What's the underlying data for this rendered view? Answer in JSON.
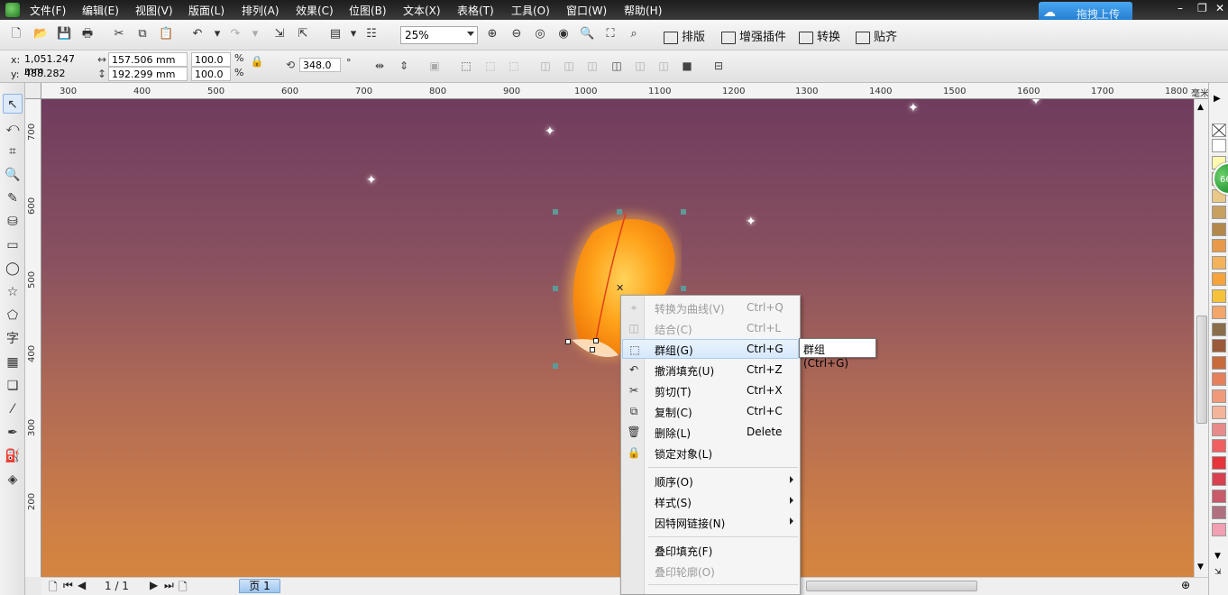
{
  "menubar": {
    "items": [
      "文件(F)",
      "编辑(E)",
      "视图(V)",
      "版面(L)",
      "排列(A)",
      "效果(C)",
      "位图(B)",
      "文本(X)",
      "表格(T)",
      "工具(O)",
      "窗口(W)",
      "帮助(H)"
    ],
    "upload_label": "拖拽上传"
  },
  "toolbar": {
    "zoom_value": "25%",
    "btn_layout": "排版",
    "btn_plugins": "增强插件",
    "btn_convert": "转换",
    "btn_snap": "贴齐"
  },
  "propbar": {
    "x_label": "x:",
    "x_value": "1,051.247 mm",
    "y_label": "y:",
    "y_value": "488.282 mm",
    "width_value": "157.506 mm",
    "height_value": "192.299 mm",
    "scale_x": "100.0",
    "scale_y": "100.0",
    "percent": "%",
    "rotation": "348.0",
    "degree": "°"
  },
  "ruler": {
    "unit": "毫米",
    "h_ticks": [
      "300",
      "400",
      "500",
      "600",
      "700",
      "800",
      "900",
      "1000",
      "1100",
      "1200",
      "1300",
      "1400",
      "1500",
      "1600",
      "1700",
      "1800"
    ],
    "v_ticks": [
      "700",
      "600",
      "500",
      "400",
      "300",
      "200"
    ]
  },
  "context_menu": {
    "items": [
      {
        "label": "转换为曲线(V)",
        "shortcut": "Ctrl+Q",
        "icon": "convert-curve-icon"
      },
      {
        "label": "结合(C)",
        "shortcut": "Ctrl+L",
        "icon": "combine-icon"
      },
      {
        "label": "群组(G)",
        "shortcut": "Ctrl+G",
        "icon": "group-icon"
      },
      {
        "label": "撤消填充(U)",
        "shortcut": "Ctrl+Z",
        "icon": "undo-icon"
      },
      {
        "label": "剪切(T)",
        "shortcut": "Ctrl+X",
        "icon": "scissors-icon"
      },
      {
        "label": "复制(C)",
        "shortcut": "Ctrl+C",
        "icon": "copy-icon"
      },
      {
        "label": "删除(L)",
        "shortcut": "Delete",
        "icon": "trash-icon"
      },
      {
        "label": "锁定对象(L)",
        "shortcut": "",
        "icon": "lock-icon"
      },
      {
        "label": "顺序(O)"
      },
      {
        "label": "样式(S)"
      },
      {
        "label": "因特网链接(N)"
      },
      {
        "label": "叠印填充(F)"
      },
      {
        "label": "叠印轮廓(O)"
      }
    ],
    "tooltip": "群组 (Ctrl+G)"
  },
  "pager": {
    "page_counter": "1 / 1",
    "page_tab": "页 1"
  },
  "badge": "66",
  "palette_colors": [
    "#ffffff",
    "#fff9b0",
    "#f7e6a0",
    "#e8c98a",
    "#c8a060",
    "#b3884a",
    "#e89a4a",
    "#f2b35a",
    "#f5a33a",
    "#f7c23a",
    "#f3a66a",
    "#8a6d4a",
    "#9a5a3a",
    "#c96a3a",
    "#e5805a",
    "#f09a7a",
    "#f4b49a",
    "#e98a8a",
    "#f06060",
    "#e8333a",
    "#d94050",
    "#c85a6a",
    "#b07080",
    "#f0a0b0"
  ]
}
